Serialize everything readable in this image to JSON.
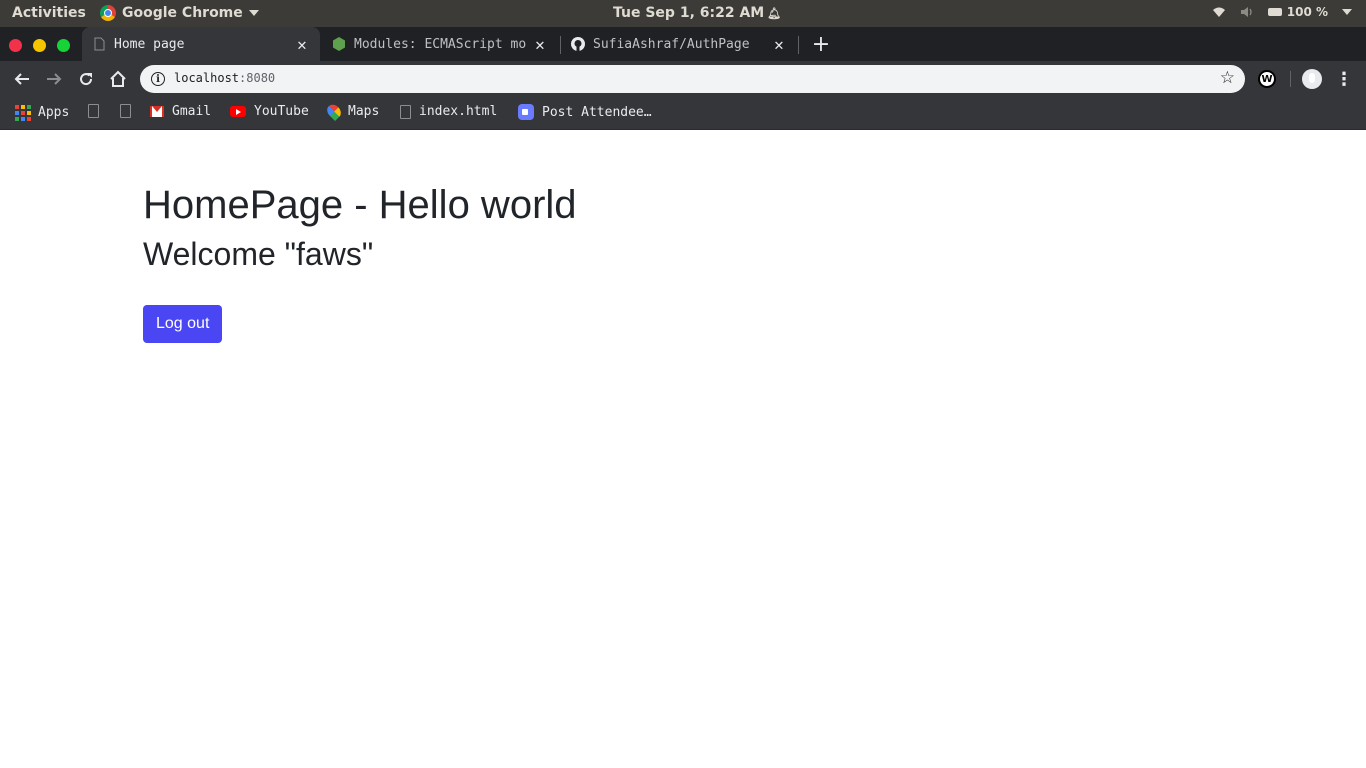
{
  "topbar": {
    "activities": "Activities",
    "app_name": "Google Chrome",
    "clock": "Tue Sep  1,  6:22 AM",
    "battery": "100 %"
  },
  "tabs": [
    {
      "label": "Home page",
      "icon": "file-icon",
      "active": true
    },
    {
      "label": "Modules: ECMAScript mo",
      "icon": "nodejs-icon",
      "active": false
    },
    {
      "label": "SufiaAshraf/AuthPage",
      "icon": "github-icon",
      "active": false
    }
  ],
  "omnibox": {
    "host": "localhost",
    "port": ":8080"
  },
  "bookmarks": {
    "apps": "Apps",
    "gmail": "Gmail",
    "youtube": "YouTube",
    "maps": "Maps",
    "index": "index.html",
    "post": "Post Attendee…"
  },
  "page": {
    "heading": "HomePage - Hello world",
    "welcome": "Welcome \"faws\"",
    "logout_label": "Log out"
  },
  "colors": {
    "button": "#4a46f3",
    "text": "#212529"
  }
}
